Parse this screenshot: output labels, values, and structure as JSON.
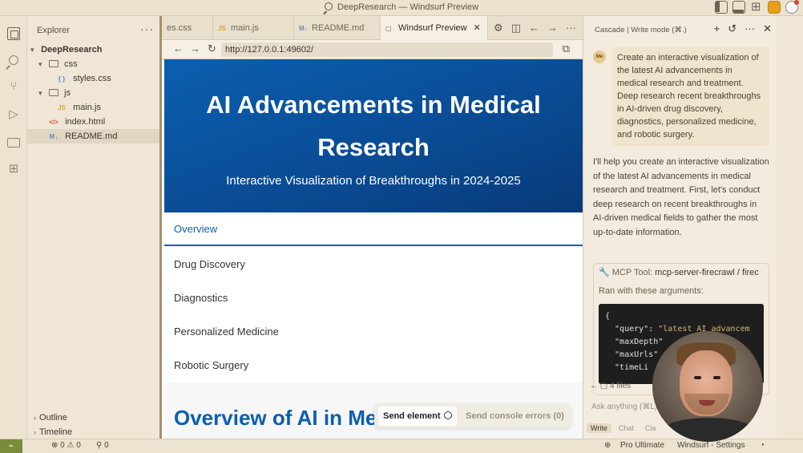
{
  "window": {
    "title": "DeepResearch — Windsurf Preview"
  },
  "explorer": {
    "header": "Explorer",
    "more": "···",
    "tree": [
      {
        "label": "DeepResearch",
        "kind": "root"
      },
      {
        "label": "css",
        "kind": "folder"
      },
      {
        "label": "styles.css",
        "kind": "css",
        "glyph": "{ }"
      },
      {
        "label": "js",
        "kind": "folder"
      },
      {
        "label": "main.js",
        "kind": "js",
        "glyph": "JS"
      },
      {
        "label": "index.html",
        "kind": "html",
        "glyph": "</>"
      },
      {
        "label": "README.md",
        "kind": "md",
        "glyph": "M↓",
        "selected": true
      }
    ],
    "sections": [
      "Outline",
      "Timeline"
    ]
  },
  "tabs": [
    {
      "label": "es.css",
      "icon": "css-file-icon"
    },
    {
      "label": "main.js",
      "icon": "js-file-icon"
    },
    {
      "label": "README.md",
      "icon": "md-file-icon"
    },
    {
      "label": "Windsurf Preview",
      "icon": "preview-icon",
      "active": true,
      "close": "✕"
    }
  ],
  "tab_tools": [
    "⚙",
    "◫",
    "←",
    "→",
    "···"
  ],
  "urlbar": {
    "back": "←",
    "forward": "→",
    "reload": "↻",
    "url": "http://127.0.0.1:49602/",
    "open_external": "⧉"
  },
  "page": {
    "hero_title": "AI Advancements in Medical Research",
    "hero_subtitle": "Interactive Visualization of Breakthroughs in 2024-2025",
    "nav": [
      "Overview",
      "Drug Discovery",
      "Diagnostics",
      "Personalized Medicine",
      "Robotic Surgery"
    ],
    "active_nav": "Overview",
    "section_heading": "Overview of AI in Medicine"
  },
  "floatbar": {
    "send_element": "Send element",
    "send_errors": "Send console errors (0)"
  },
  "cascade": {
    "header": "Cascade | Write mode (⌘.)",
    "tools": [
      "+",
      "↺",
      "···",
      "✕"
    ],
    "avatar": "Me",
    "user_message": "Create an interactive visualization of the latest AI advancements in medical research and treatment. Deep research recent breakthroughs in AI-driven drug discovery, diagnostics, personalized medicine, and robotic surgery.",
    "assistant_message": "I'll help you create an interactive visualization of the latest AI advancements in medical research and treatment. First, let's conduct deep research on recent breakthroughs in AI-driven medical fields to gather the most up-to-date information.",
    "tool_label": "MCP Tool:",
    "tool_name": "mcp-server-firecrawl / firec",
    "tool_args_label": "Ran with these arguments:",
    "code_lines": [
      {
        "k": "{",
        "v": ""
      },
      {
        "k": "  \"query\": ",
        "v": "\"latest AI advancem"
      },
      {
        "k": "  \"maxDepth\"",
        "v": ""
      },
      {
        "k": "  \"maxUrls\"",
        "v": ""
      },
      {
        "k": "  \"timeLi",
        "v": ""
      }
    ],
    "files_text": "4 files",
    "ask_placeholder": "Ask anything (⌘L)",
    "modes": [
      "Write",
      "Chat",
      "Cla"
    ]
  },
  "statusbar": {
    "remote_glyph": "⌁",
    "problems": "⊗ 0 ⚠ 0",
    "ports": "⚲ 0",
    "plan": "Pro Ultimate",
    "settings": "Windsurf - Settings",
    "bell": "🔔"
  },
  "colors": {
    "hero_start": "#0b5fb0",
    "hero_end": "#073a78",
    "accent_blue": "#0c62b5",
    "app_bg": "#efe6d6"
  }
}
